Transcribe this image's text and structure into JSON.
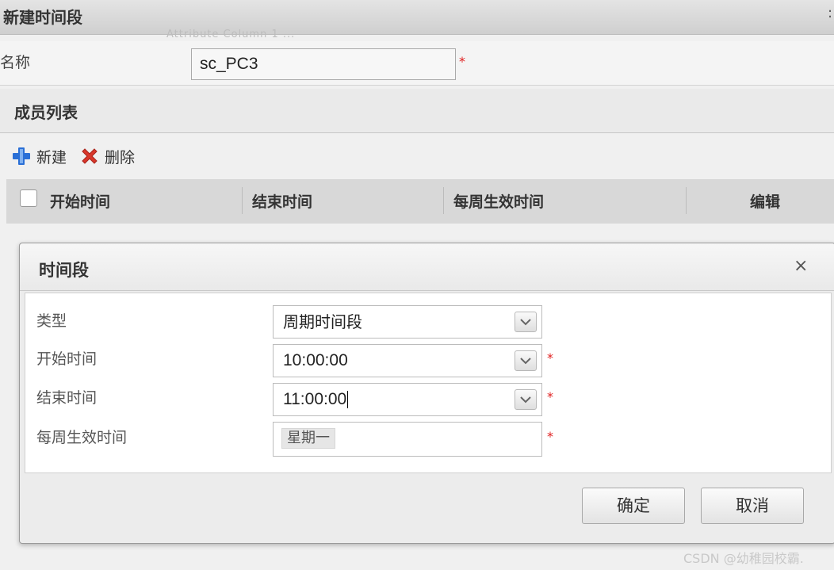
{
  "window": {
    "title": "新建时间段",
    "ghost_text": "Attribute   Column   1 ..."
  },
  "form": {
    "name_label": "名称",
    "name_value": "sc_PC3",
    "required_mark": "*"
  },
  "members": {
    "title": "成员列表",
    "toolbar": {
      "new_label": "新建",
      "delete_label": "删除"
    },
    "columns": [
      "开始时间",
      "结束时间",
      "每周生效时间",
      "编辑"
    ]
  },
  "dialog": {
    "title": "时间段",
    "close_glyph": "×",
    "fields": {
      "type": {
        "label": "类型",
        "value": "周期时间段"
      },
      "start": {
        "label": "开始时间",
        "value": "10:00:00"
      },
      "end": {
        "label": "结束时间",
        "value": "11:00:00"
      },
      "weekly": {
        "label": "每周生效时间",
        "tag": "星期一"
      }
    },
    "buttons": {
      "confirm": "确定",
      "cancel": "取消"
    }
  },
  "watermark": "CSDN @幼稚园校霸.",
  "colors": {
    "required": "#e02020",
    "plus_icon": "#2a6fd6",
    "delete_icon": "#d9372b"
  }
}
